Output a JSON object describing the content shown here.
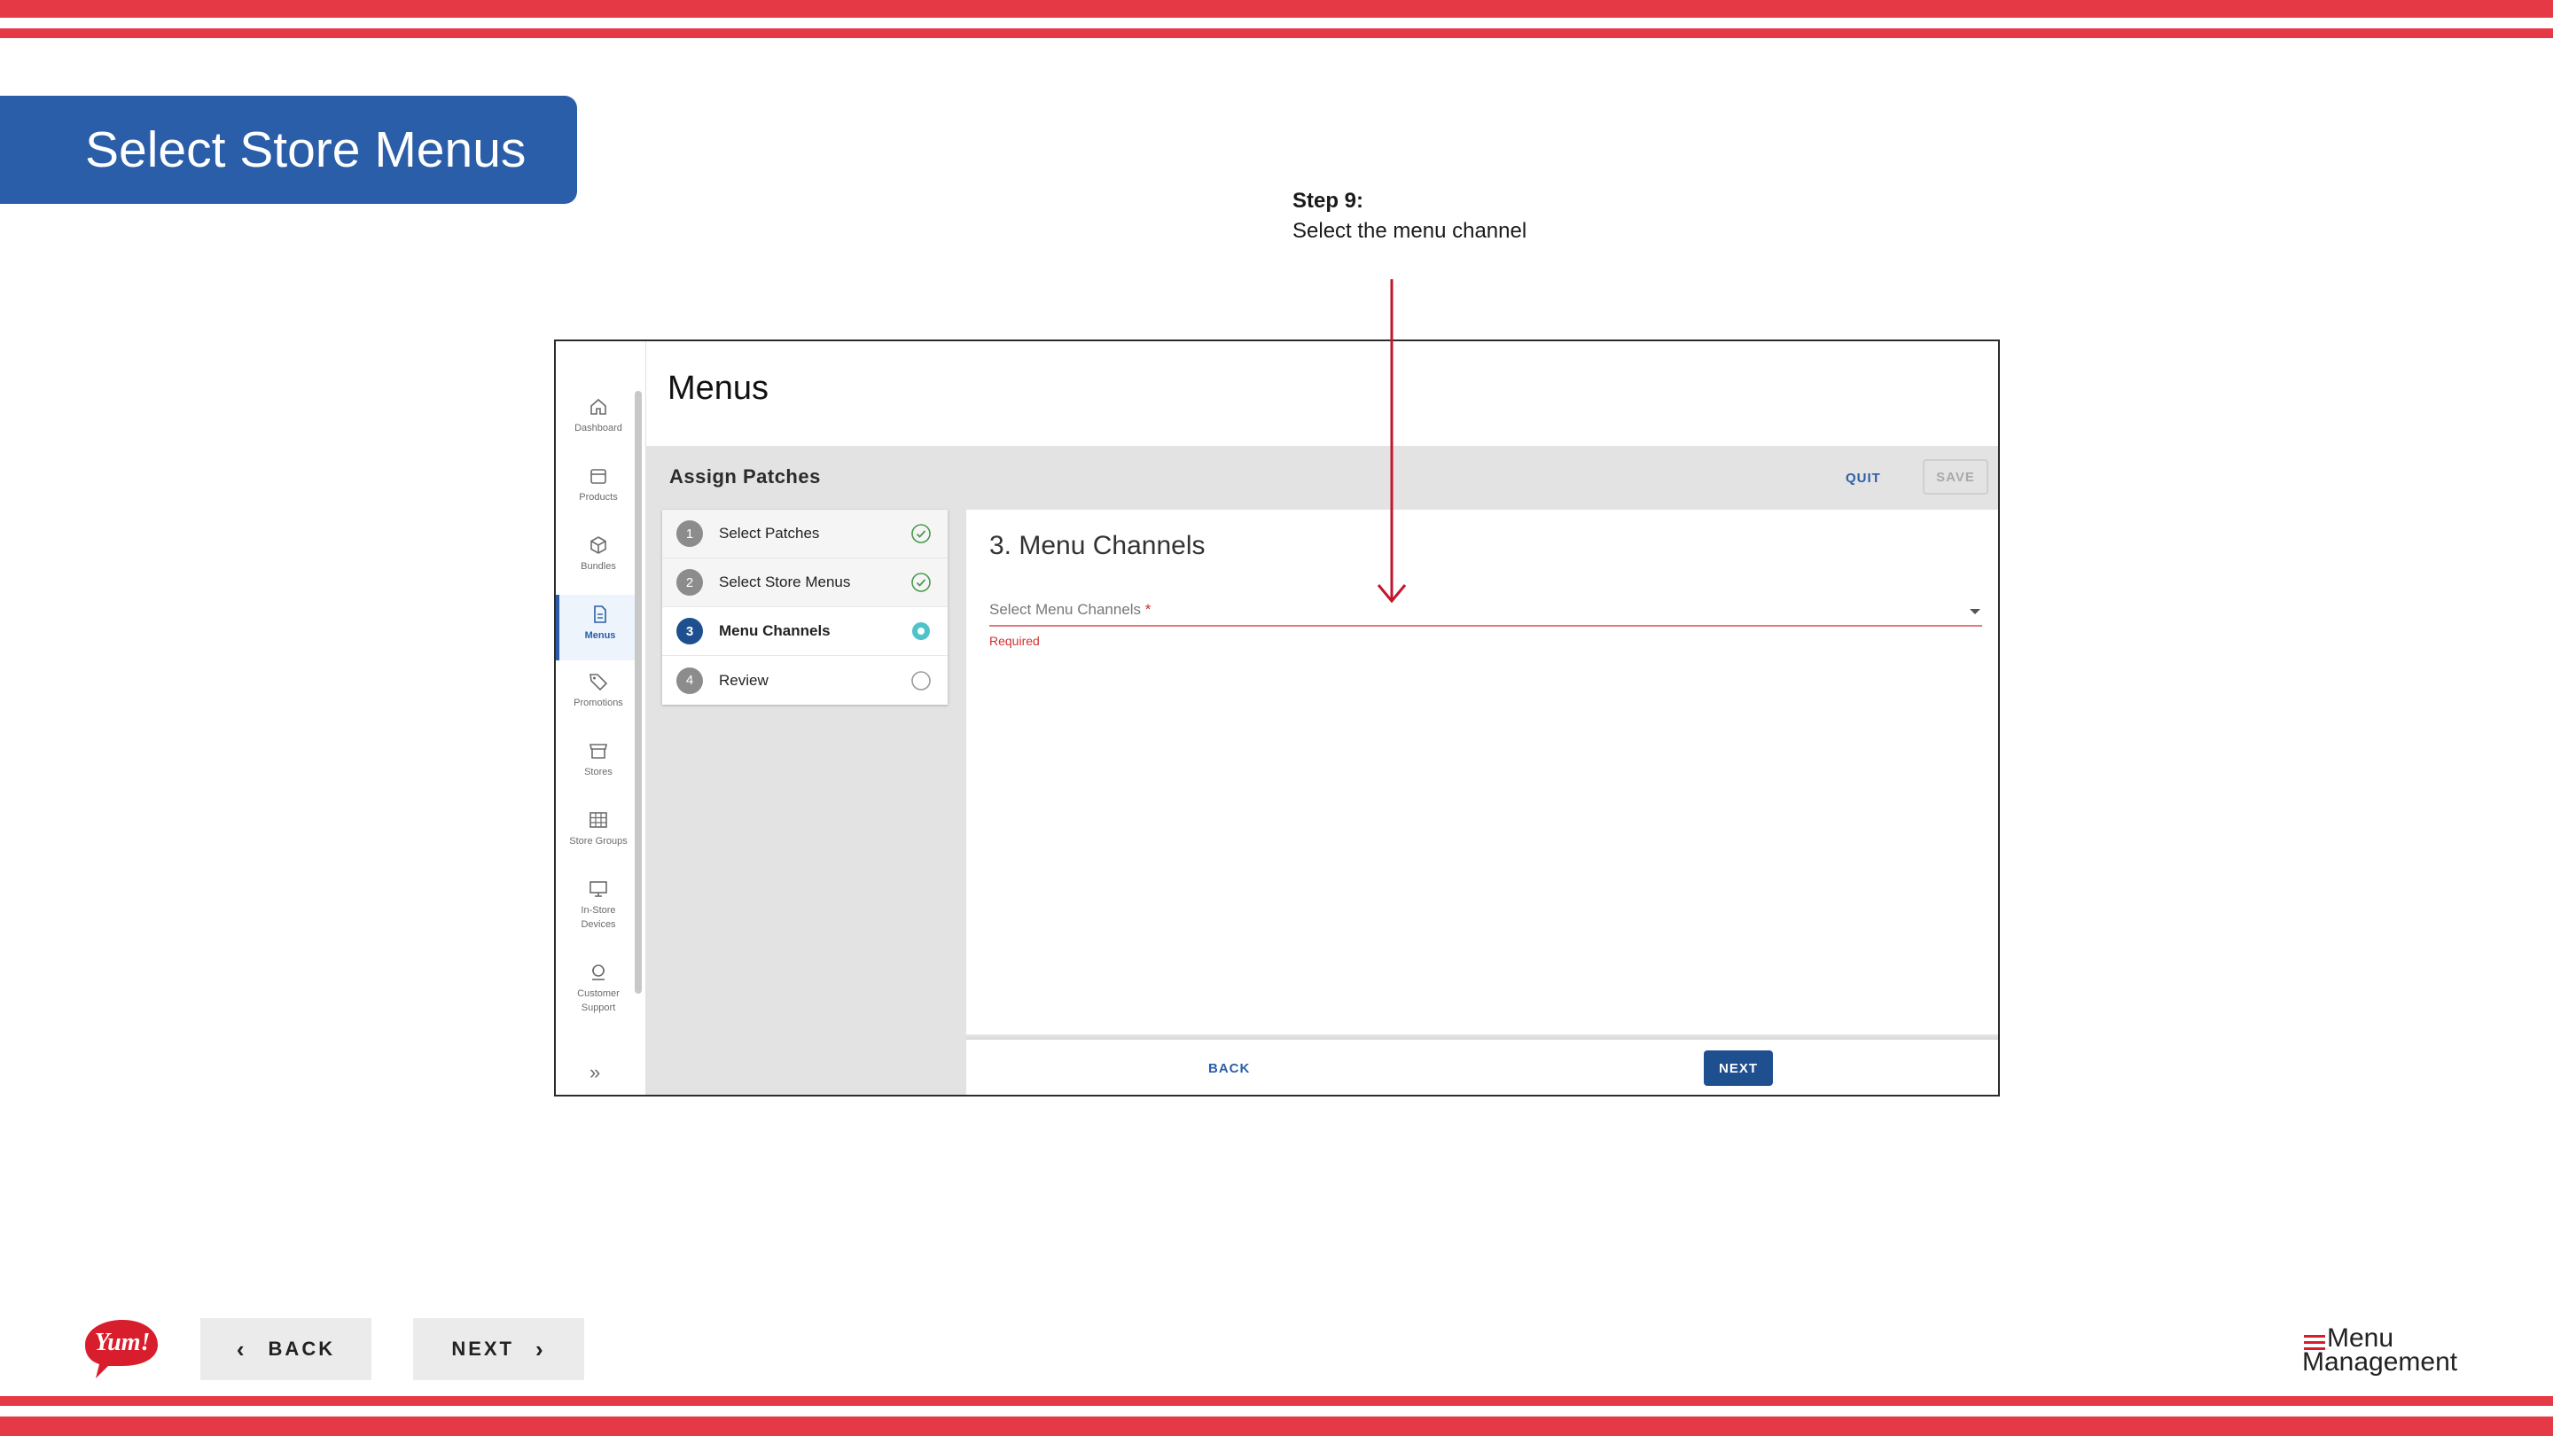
{
  "slide": {
    "title": "Select Store Menus",
    "callout": {
      "heading": "Step 9:",
      "body": "Select the menu channel"
    },
    "nav": {
      "back": "BACK",
      "next": "NEXT"
    },
    "brand": {
      "yum": "Yum!",
      "menu_management_line1": "Menu",
      "menu_management_line2": "Management"
    },
    "colors": {
      "stripe": "#e63946",
      "title_bg": "#2a5ea8",
      "arrow": "#c0172d"
    }
  },
  "app": {
    "page_title": "Menus",
    "rail": [
      {
        "label": "Dashboard",
        "icon": "home-icon"
      },
      {
        "label": "Products",
        "icon": "box-icon"
      },
      {
        "label": "Bundles",
        "icon": "cube-icon"
      },
      {
        "label": "Menus",
        "icon": "document-icon",
        "active": true
      },
      {
        "label": "Promotions",
        "icon": "tag-icon"
      },
      {
        "label": "Stores",
        "icon": "store-icon"
      },
      {
        "label": "Store Groups",
        "icon": "grid-icon"
      },
      {
        "label": "In-Store Devices",
        "icon": "monitor-icon"
      },
      {
        "label": "Customer Support",
        "icon": "support-icon"
      }
    ],
    "assign": {
      "title": "Assign Patches",
      "quit": "QUIT",
      "save": "SAVE",
      "steps": [
        {
          "num": "1",
          "label": "Select Patches",
          "status": "complete"
        },
        {
          "num": "2",
          "label": "Select Store Menus",
          "status": "complete"
        },
        {
          "num": "3",
          "label": "Menu Channels",
          "status": "active"
        },
        {
          "num": "4",
          "label": "Review",
          "status": "pending"
        }
      ]
    },
    "content": {
      "section_title": "3. Menu Channels",
      "select_label": "Select Menu Channels",
      "required_marker": "*",
      "error_text": "Required",
      "back": "BACK",
      "next": "NEXT"
    }
  }
}
